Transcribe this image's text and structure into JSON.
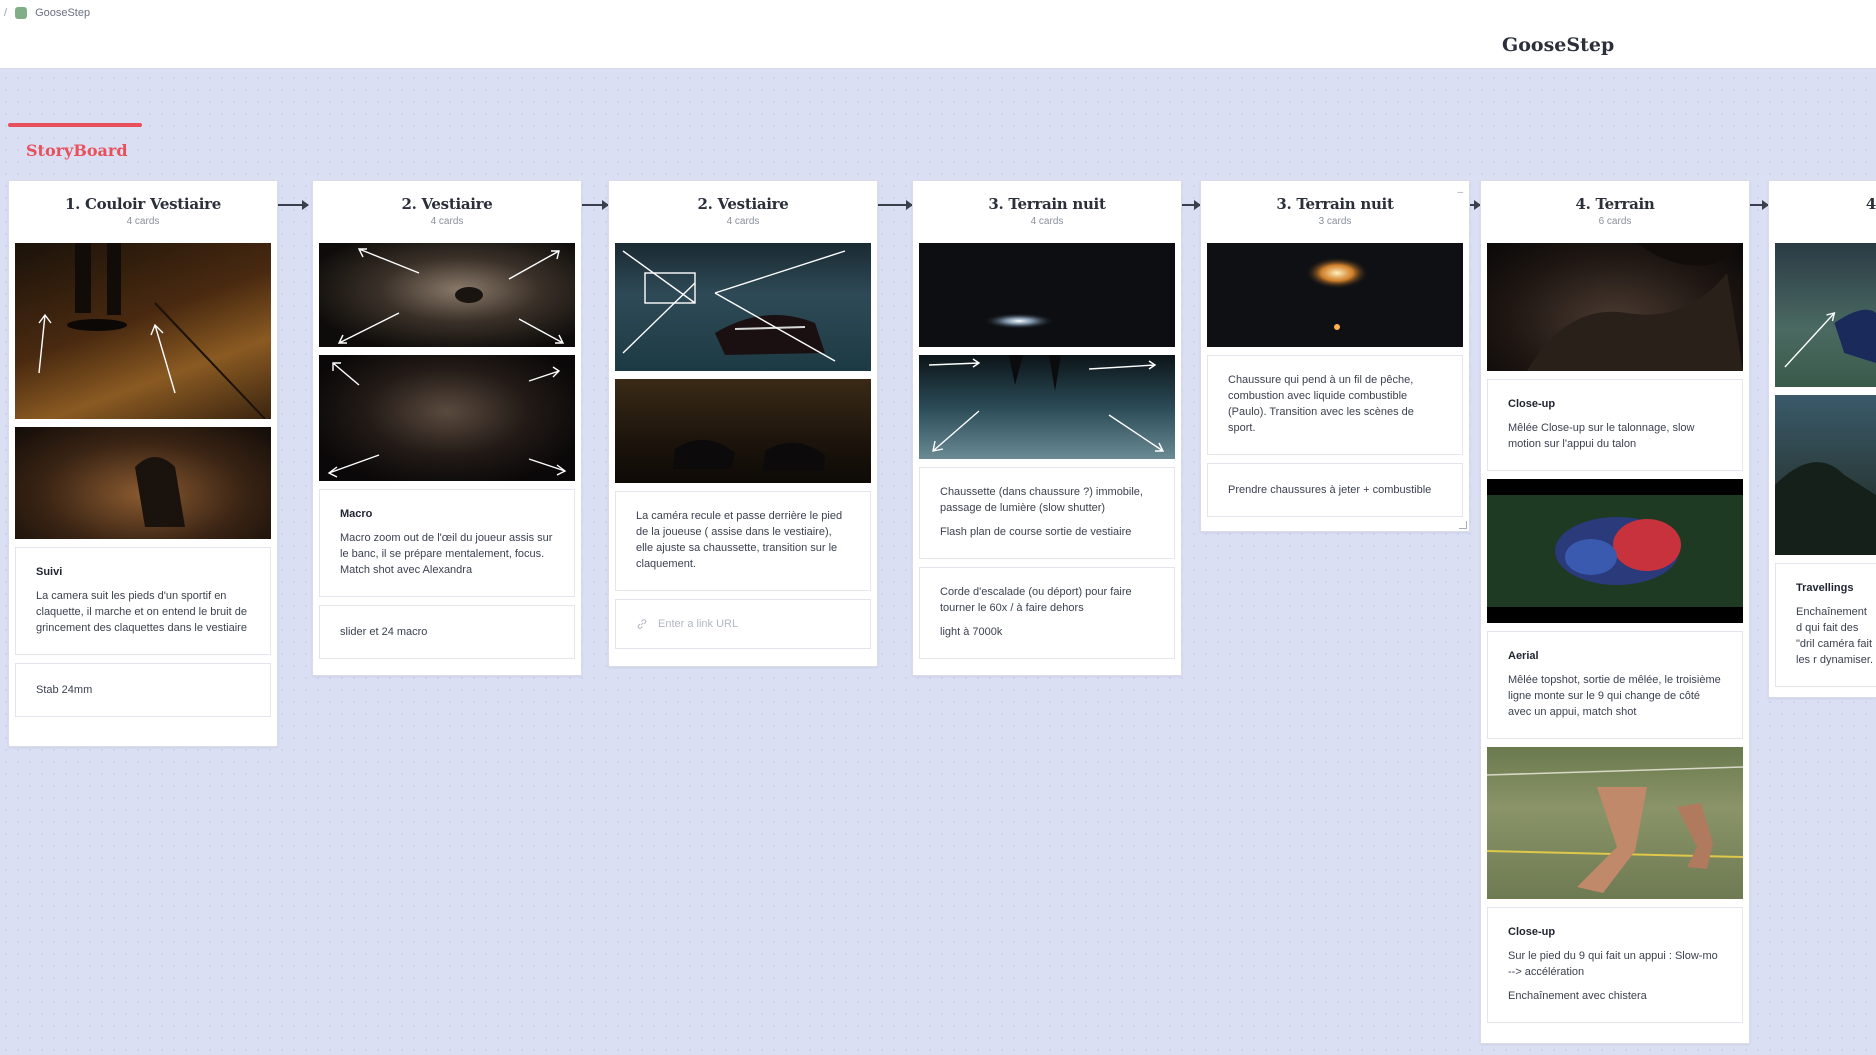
{
  "breadcrumb": {
    "separator": "/",
    "board": "GooseStep"
  },
  "board_title": "GooseStep",
  "storyboard_label": "StoryBoard",
  "columns": [
    {
      "title": "1. Couloir Vestiaire",
      "count": "4 cards",
      "cards": [
        {
          "title": "Suivi",
          "text": "La camera suit les pieds d'un sportif en claquette, il marche et on entend le bruit de grincement des claquettes dans le vestiaire"
        },
        {
          "text": "Stab 24mm"
        }
      ]
    },
    {
      "title": "2. Vestiaire",
      "count": "4 cards",
      "cards": [
        {
          "title": "Macro",
          "text": "Macro zoom out de l'œil du joueur assis sur le banc, il se prépare mentalement, focus. Match shot avec Alexandra"
        },
        {
          "text": "slider et 24 macro"
        }
      ]
    },
    {
      "title": "2. Vestiaire",
      "count": "4 cards",
      "cards": [
        {
          "text": "La caméra recule et passe derrière le pied de la joueuse ( assise dans le vestiaire), elle ajuste sa chaussette, transition sur le claquement."
        }
      ],
      "link_placeholder": "Enter a link URL"
    },
    {
      "title": "3. Terrain nuit",
      "count": "4 cards",
      "cards": [
        {
          "text": "Chaussette (dans chaussure ?) immobile, passage de lumière (slow shutter)",
          "text2": "Flash plan de course sortie de vestiaire"
        },
        {
          "text": "Corde d'escalade (ou déport) pour faire tourner le 60x / à faire dehors",
          "text2": "light à 7000k"
        }
      ]
    },
    {
      "title": "3. Terrain nuit",
      "count": "3 cards",
      "option": "–",
      "cards": [
        {
          "text": "Chaussure qui pend à un fil de pêche, combustion avec liquide combustible (Paulo). Transition avec les scènes de sport."
        },
        {
          "text": "Prendre chaussures à jeter + combustible"
        }
      ]
    },
    {
      "title": "4. Terrain",
      "count": "6 cards",
      "cards": [
        {
          "title": "Close-up",
          "text": "Mêlée Close-up sur le talonnage, slow motion sur l'appui du talon"
        },
        {
          "title": "Aerial",
          "text": "Mêlée topshot, sortie de mêlée, le troisième ligne monte sur le 9 qui change de côté avec un appui, match shot"
        },
        {
          "title": "Close-up",
          "text": "Sur le pied du 9 qui fait un appui : Slow-mo --> accélération",
          "text2": "Enchaînement avec chistera"
        }
      ]
    },
    {
      "title": "4",
      "cards": [
        {
          "title": "Travellings",
          "text": "Enchaînement d qui fait des \"dril caméra fait les r dynamiser."
        }
      ]
    }
  ]
}
